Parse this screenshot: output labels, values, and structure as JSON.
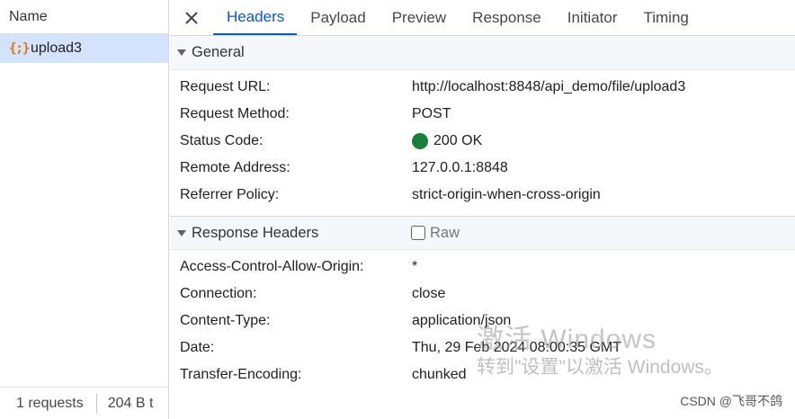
{
  "network_list": {
    "column_header": "Name",
    "requests": [
      {
        "icon": "{;}",
        "name": "upload3"
      }
    ],
    "footer": {
      "requests_count": "1 requests",
      "transferred": "204 B t"
    }
  },
  "tabs": {
    "close_icon": "✕",
    "items": [
      {
        "label": "Headers",
        "active": true
      },
      {
        "label": "Payload",
        "active": false
      },
      {
        "label": "Preview",
        "active": false
      },
      {
        "label": "Response",
        "active": false
      },
      {
        "label": "Initiator",
        "active": false
      },
      {
        "label": "Timing",
        "active": false
      }
    ]
  },
  "general": {
    "title": "General",
    "rows": [
      {
        "key": "Request URL:",
        "value": "http://localhost:8848/api_demo/file/upload3"
      },
      {
        "key": "Request Method:",
        "value": "POST"
      },
      {
        "key": "Status Code:",
        "value": "200 OK"
      },
      {
        "key": "Remote Address:",
        "value": "127.0.0.1:8848"
      },
      {
        "key": "Referrer Policy:",
        "value": "strict-origin-when-cross-origin"
      }
    ]
  },
  "response_headers": {
    "title": "Response Headers",
    "raw_label": "Raw",
    "rows": [
      {
        "key": "Access-Control-Allow-Origin:",
        "value": "*"
      },
      {
        "key": "Connection:",
        "value": "close"
      },
      {
        "key": "Content-Type:",
        "value": "application/json"
      },
      {
        "key": "Date:",
        "value": "Thu, 29 Feb 2024 08:00:35 GMT"
      },
      {
        "key": "Transfer-Encoding:",
        "value": "chunked"
      }
    ]
  },
  "watermark": {
    "line1": "激活 Windows",
    "line2": "转到\"设置\"以激活 Windows。"
  },
  "credit": "CSDN @飞哥不鸽",
  "colors": {
    "accent": "#0b57d0",
    "status_ok": "#188038",
    "selected_row": "#d3e3fd"
  }
}
